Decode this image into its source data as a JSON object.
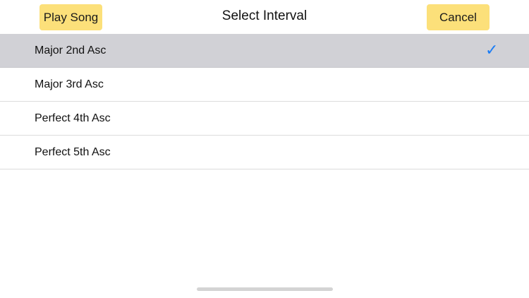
{
  "nav": {
    "left_button": "Play Song",
    "title": "Select Interval",
    "right_button": "Cancel"
  },
  "intervals": [
    {
      "label": "Major 2nd Asc",
      "selected": true
    },
    {
      "label": "Major 3rd Asc",
      "selected": false
    },
    {
      "label": "Perfect 4th Asc",
      "selected": false
    },
    {
      "label": "Perfect 5th Asc",
      "selected": false
    }
  ],
  "check_icon": "checkmark-icon",
  "colors": {
    "button_bg": "#fce07a",
    "selected_row_bg": "#d1d1d6",
    "checkmark": "#1a7cf5"
  }
}
